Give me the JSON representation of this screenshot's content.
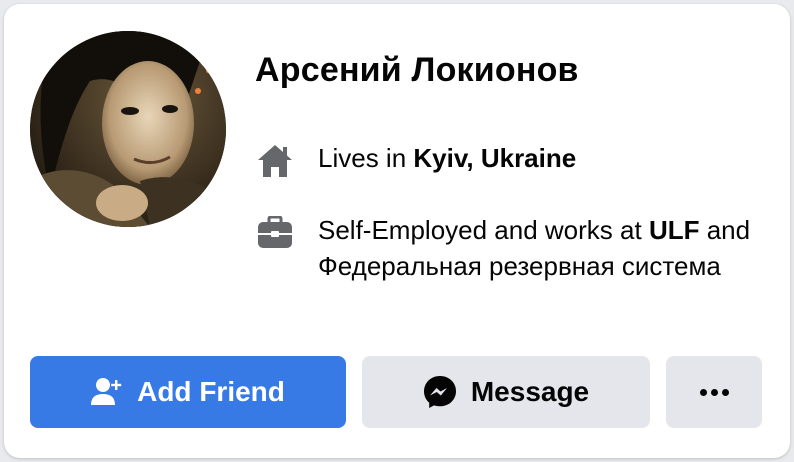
{
  "profile": {
    "name": "Арсений Локионов",
    "avatar_icon": "profile-photo"
  },
  "info": {
    "home": {
      "icon": "home-icon",
      "prefix": "Lives in ",
      "place": "Kyiv, Ukraine"
    },
    "work": {
      "icon": "briefcase-icon",
      "prefix": "Self-Employed and works at ",
      "company1": "ULF",
      "connector": " and Федеральная резервная система"
    }
  },
  "actions": {
    "add_friend": {
      "label": "Add Friend",
      "icon": "add-friend-icon",
      "color": "#377ae5"
    },
    "message": {
      "label": "Message",
      "icon": "messenger-icon"
    },
    "more": {
      "icon": "more-icon"
    }
  },
  "colors": {
    "card_bg": "#ffffff",
    "button_secondary": "#e4e6eb",
    "icon_gray": "#65676b",
    "text": "#050505"
  }
}
